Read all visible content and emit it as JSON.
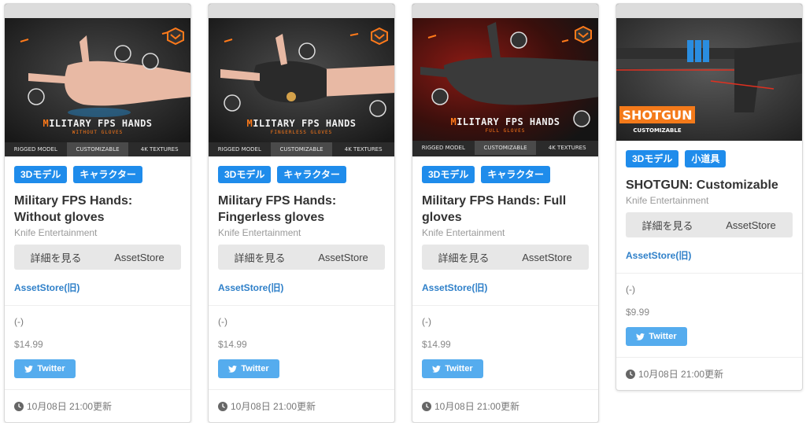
{
  "cards": [
    {
      "art_title_first": "M",
      "art_title_rest": "ILITARY FPS HANDS",
      "art_subtitle": "WITHOUT GLOVES",
      "thumb_bar": [
        "RIGGED MODEL",
        "CUSTOMIZABLE",
        "4K TEXTURES"
      ],
      "tags": [
        "3Dモデル",
        "キャラクター"
      ],
      "title": "Military FPS Hands: Without gloves",
      "maker": "Knife Entertainment",
      "detail_button": "詳細を見る",
      "store_button": "AssetStore",
      "old_link": "AssetStore(旧)",
      "rating": "(-)",
      "price": "$14.99",
      "twitter": "Twitter",
      "updated": "10月08日 21:00更新"
    },
    {
      "art_title_first": "M",
      "art_title_rest": "ILITARY FPS HANDS",
      "art_subtitle": "FINGERLESS GLOVES",
      "thumb_bar": [
        "RIGGED MODEL",
        "CUSTOMIZABLE",
        "4K TEXTURES"
      ],
      "tags": [
        "3Dモデル",
        "キャラクター"
      ],
      "title": "Military FPS Hands: Fingerless gloves",
      "maker": "Knife Entertainment",
      "detail_button": "詳細を見る",
      "store_button": "AssetStore",
      "old_link": "AssetStore(旧)",
      "rating": "(-)",
      "price": "$14.99",
      "twitter": "Twitter",
      "updated": "10月08日 21:00更新"
    },
    {
      "art_title_first": "M",
      "art_title_rest": "ILITARY FPS HANDS",
      "art_subtitle": "FULL GLOVES",
      "thumb_bar": [
        "RIGGED MODEL",
        "CUSTOMIZABLE",
        "4K TEXTURES"
      ],
      "tags": [
        "3Dモデル",
        "キャラクター"
      ],
      "title": "Military FPS Hands: Full gloves",
      "maker": "Knife Entertainment",
      "detail_button": "詳細を見る",
      "store_button": "AssetStore",
      "old_link": "AssetStore(旧)",
      "rating": "(-)",
      "price": "$14.99",
      "twitter": "Twitter",
      "updated": "10月08日 21:00更新"
    },
    {
      "art_title_first": "SHOTGUN",
      "art_subtitle": "CUSTOMIZABLE",
      "tags": [
        "3Dモデル",
        "小道具"
      ],
      "title": "SHOTGUN: Customizable",
      "maker": "Knife Entertainment",
      "detail_button": "詳細を見る",
      "store_button": "AssetStore",
      "old_link": "AssetStore(旧)",
      "rating": "(-)",
      "price": "$9.99",
      "twitter": "Twitter",
      "updated": "10月08日 21:00更新"
    }
  ],
  "colors": {
    "tag": "#1f8ceb",
    "link": "#2f80c9",
    "twitter": "#55acee",
    "accent_orange": "#ff7a1a"
  }
}
